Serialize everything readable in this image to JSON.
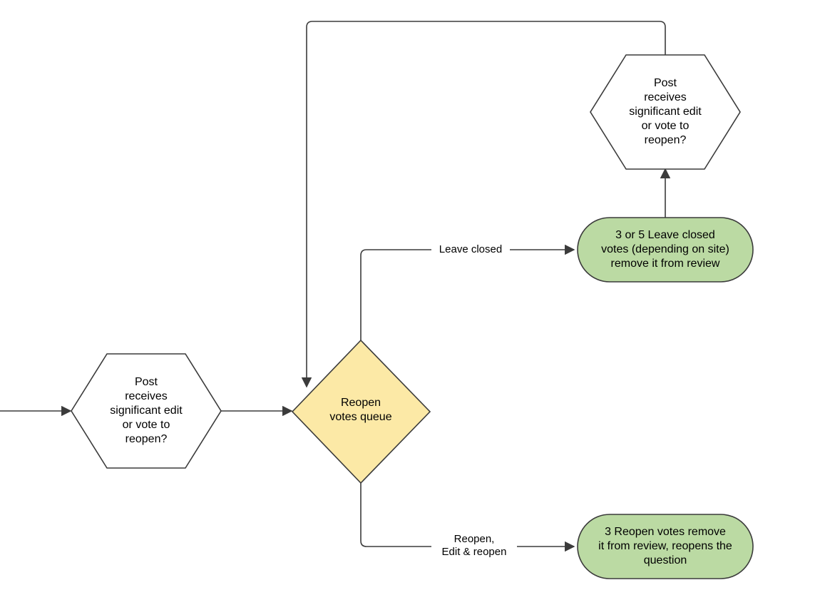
{
  "nodes": {
    "hexLeft": {
      "l1": "Post",
      "l2": "receives",
      "l3": "significant edit",
      "l4": "or vote to",
      "l5": "reopen?"
    },
    "hexRight": {
      "l1": "Post",
      "l2": "receives",
      "l3": "significant edit",
      "l4": "or vote to",
      "l5": "reopen?"
    },
    "diamond": {
      "l1": "Reopen",
      "l2": "votes queue"
    },
    "roundTop": {
      "l1": "3 or 5 Leave closed",
      "l2": "votes (depending on site)",
      "l3": "remove it from review"
    },
    "roundBottom": {
      "l1": "3 Reopen votes remove",
      "l2": "it from review, reopens the",
      "l3": "question"
    }
  },
  "edges": {
    "leaveClosed": "Leave closed",
    "reopen1": "Reopen,",
    "reopen2": "Edit & reopen"
  },
  "colors": {
    "stroke": "#3b3b3b",
    "hexFill": "#ffffff",
    "diamondFill": "#fce9a6",
    "roundFill": "#bbdaa3"
  }
}
